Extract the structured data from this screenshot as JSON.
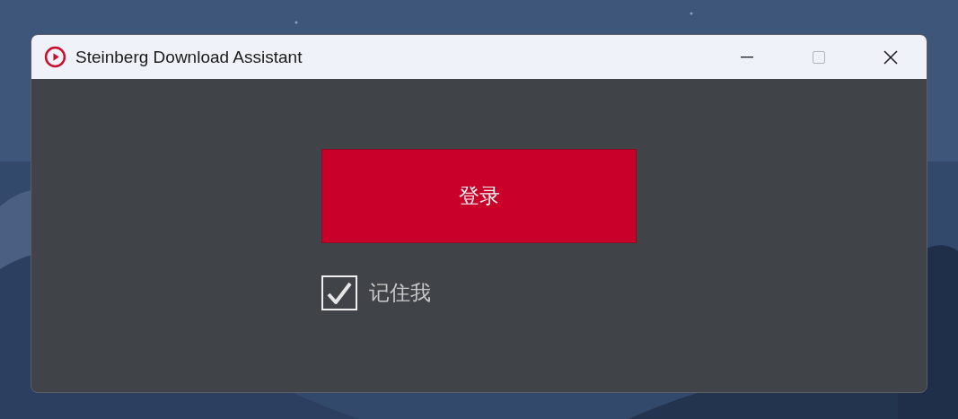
{
  "window": {
    "title": "Steinberg Download Assistant",
    "maximize_disabled": true
  },
  "login_button": {
    "label": "登录"
  },
  "remember_me": {
    "label": "记住我",
    "checked": true
  }
}
